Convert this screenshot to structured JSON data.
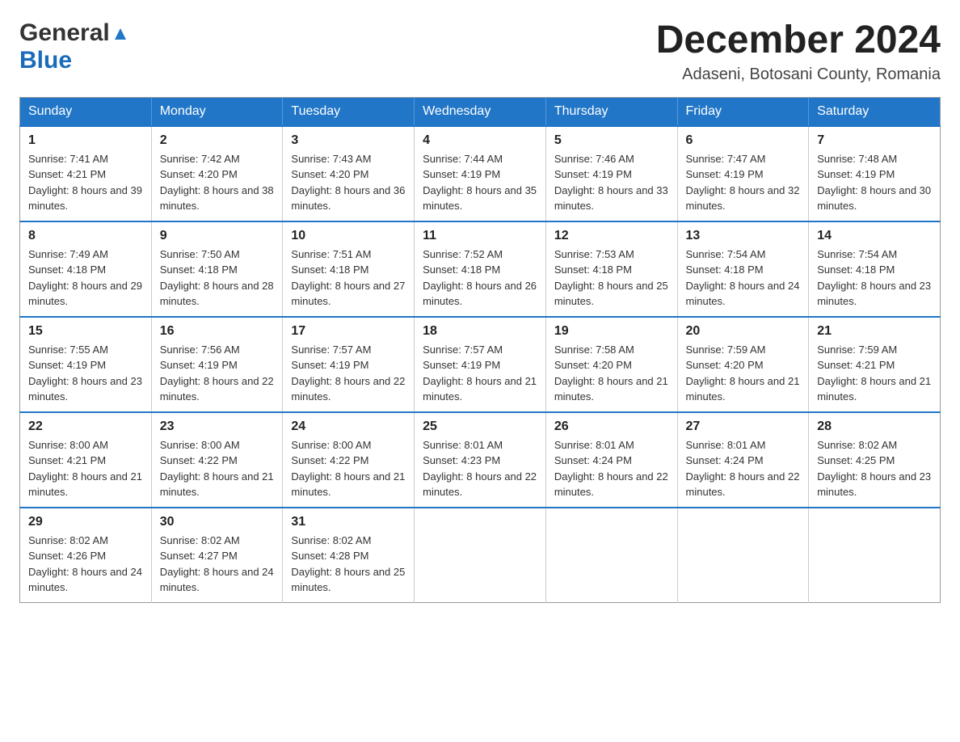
{
  "header": {
    "title": "December 2024",
    "location": "Adaseni, Botosani County, Romania",
    "logo_general": "General",
    "logo_blue": "Blue"
  },
  "calendar": {
    "days_of_week": [
      "Sunday",
      "Monday",
      "Tuesday",
      "Wednesday",
      "Thursday",
      "Friday",
      "Saturday"
    ],
    "weeks": [
      [
        {
          "day": "1",
          "sunrise": "7:41 AM",
          "sunset": "4:21 PM",
          "daylight": "8 hours and 39 minutes."
        },
        {
          "day": "2",
          "sunrise": "7:42 AM",
          "sunset": "4:20 PM",
          "daylight": "8 hours and 38 minutes."
        },
        {
          "day": "3",
          "sunrise": "7:43 AM",
          "sunset": "4:20 PM",
          "daylight": "8 hours and 36 minutes."
        },
        {
          "day": "4",
          "sunrise": "7:44 AM",
          "sunset": "4:19 PM",
          "daylight": "8 hours and 35 minutes."
        },
        {
          "day": "5",
          "sunrise": "7:46 AM",
          "sunset": "4:19 PM",
          "daylight": "8 hours and 33 minutes."
        },
        {
          "day": "6",
          "sunrise": "7:47 AM",
          "sunset": "4:19 PM",
          "daylight": "8 hours and 32 minutes."
        },
        {
          "day": "7",
          "sunrise": "7:48 AM",
          "sunset": "4:19 PM",
          "daylight": "8 hours and 30 minutes."
        }
      ],
      [
        {
          "day": "8",
          "sunrise": "7:49 AM",
          "sunset": "4:18 PM",
          "daylight": "8 hours and 29 minutes."
        },
        {
          "day": "9",
          "sunrise": "7:50 AM",
          "sunset": "4:18 PM",
          "daylight": "8 hours and 28 minutes."
        },
        {
          "day": "10",
          "sunrise": "7:51 AM",
          "sunset": "4:18 PM",
          "daylight": "8 hours and 27 minutes."
        },
        {
          "day": "11",
          "sunrise": "7:52 AM",
          "sunset": "4:18 PM",
          "daylight": "8 hours and 26 minutes."
        },
        {
          "day": "12",
          "sunrise": "7:53 AM",
          "sunset": "4:18 PM",
          "daylight": "8 hours and 25 minutes."
        },
        {
          "day": "13",
          "sunrise": "7:54 AM",
          "sunset": "4:18 PM",
          "daylight": "8 hours and 24 minutes."
        },
        {
          "day": "14",
          "sunrise": "7:54 AM",
          "sunset": "4:18 PM",
          "daylight": "8 hours and 23 minutes."
        }
      ],
      [
        {
          "day": "15",
          "sunrise": "7:55 AM",
          "sunset": "4:19 PM",
          "daylight": "8 hours and 23 minutes."
        },
        {
          "day": "16",
          "sunrise": "7:56 AM",
          "sunset": "4:19 PM",
          "daylight": "8 hours and 22 minutes."
        },
        {
          "day": "17",
          "sunrise": "7:57 AM",
          "sunset": "4:19 PM",
          "daylight": "8 hours and 22 minutes."
        },
        {
          "day": "18",
          "sunrise": "7:57 AM",
          "sunset": "4:19 PM",
          "daylight": "8 hours and 21 minutes."
        },
        {
          "day": "19",
          "sunrise": "7:58 AM",
          "sunset": "4:20 PM",
          "daylight": "8 hours and 21 minutes."
        },
        {
          "day": "20",
          "sunrise": "7:59 AM",
          "sunset": "4:20 PM",
          "daylight": "8 hours and 21 minutes."
        },
        {
          "day": "21",
          "sunrise": "7:59 AM",
          "sunset": "4:21 PM",
          "daylight": "8 hours and 21 minutes."
        }
      ],
      [
        {
          "day": "22",
          "sunrise": "8:00 AM",
          "sunset": "4:21 PM",
          "daylight": "8 hours and 21 minutes."
        },
        {
          "day": "23",
          "sunrise": "8:00 AM",
          "sunset": "4:22 PM",
          "daylight": "8 hours and 21 minutes."
        },
        {
          "day": "24",
          "sunrise": "8:00 AM",
          "sunset": "4:22 PM",
          "daylight": "8 hours and 21 minutes."
        },
        {
          "day": "25",
          "sunrise": "8:01 AM",
          "sunset": "4:23 PM",
          "daylight": "8 hours and 22 minutes."
        },
        {
          "day": "26",
          "sunrise": "8:01 AM",
          "sunset": "4:24 PM",
          "daylight": "8 hours and 22 minutes."
        },
        {
          "day": "27",
          "sunrise": "8:01 AM",
          "sunset": "4:24 PM",
          "daylight": "8 hours and 22 minutes."
        },
        {
          "day": "28",
          "sunrise": "8:02 AM",
          "sunset": "4:25 PM",
          "daylight": "8 hours and 23 minutes."
        }
      ],
      [
        {
          "day": "29",
          "sunrise": "8:02 AM",
          "sunset": "4:26 PM",
          "daylight": "8 hours and 24 minutes."
        },
        {
          "day": "30",
          "sunrise": "8:02 AM",
          "sunset": "4:27 PM",
          "daylight": "8 hours and 24 minutes."
        },
        {
          "day": "31",
          "sunrise": "8:02 AM",
          "sunset": "4:28 PM",
          "daylight": "8 hours and 25 minutes."
        },
        null,
        null,
        null,
        null
      ]
    ],
    "labels": {
      "sunrise": "Sunrise:",
      "sunset": "Sunset:",
      "daylight": "Daylight:"
    }
  }
}
